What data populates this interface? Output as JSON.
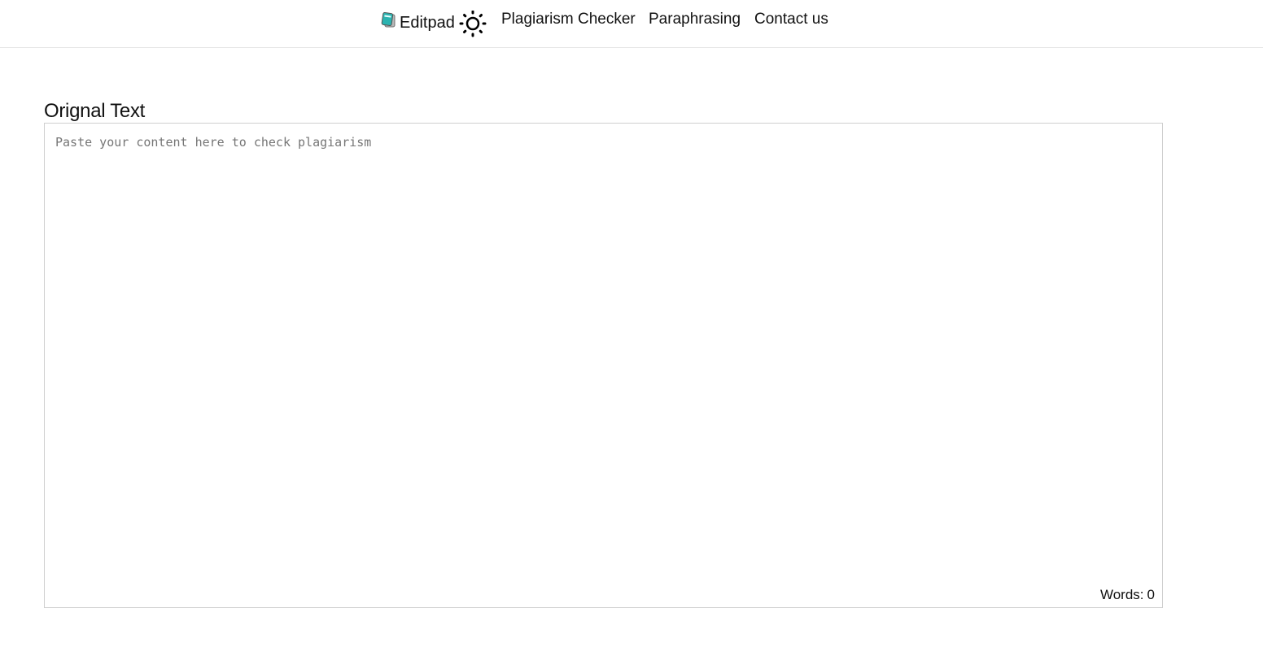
{
  "header": {
    "brand_name": "Editpad",
    "brand_icon": "notepad-icon",
    "theme_icon": "sun-icon",
    "nav": {
      "plagiarism_checker": "Plagiarism Checker",
      "paraphrasing": "Paraphrasing",
      "contact_us": "Contact us"
    }
  },
  "main": {
    "section_title": "Orignal Text",
    "editor": {
      "value": "",
      "placeholder": "Paste your content here to check plagiarism"
    },
    "word_count": {
      "label": "Words:",
      "value": "0"
    }
  },
  "colors": {
    "brand_icon_teal": "#2bb3b0",
    "border": "#cfcfcf",
    "placeholder": "#767676"
  }
}
